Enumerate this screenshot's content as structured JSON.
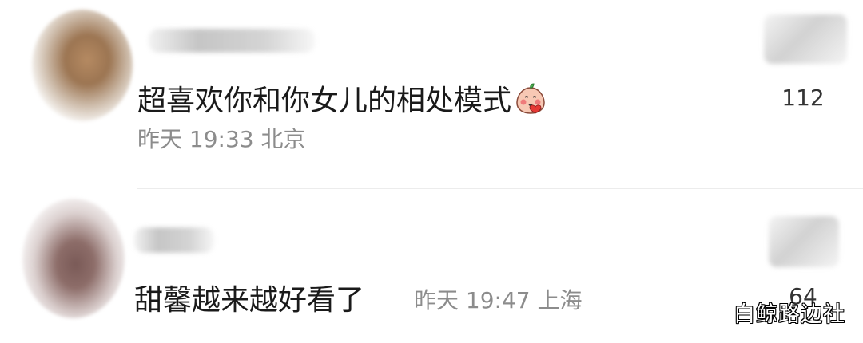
{
  "comments": [
    {
      "text": "超喜欢你和你女儿的相处模式",
      "emoji": "blushing-peach-emoji",
      "meta": "昨天 19:33 北京",
      "likes": "112"
    },
    {
      "text": "甜馨越来越好看了",
      "meta": "昨天 19:47 上海",
      "likes": "64"
    }
  ],
  "watermark": "白鲸路边社",
  "colors": {
    "text": "#1a1a1a",
    "meta": "#8c8c8c",
    "count": "#333333",
    "divider": "#ececec"
  }
}
